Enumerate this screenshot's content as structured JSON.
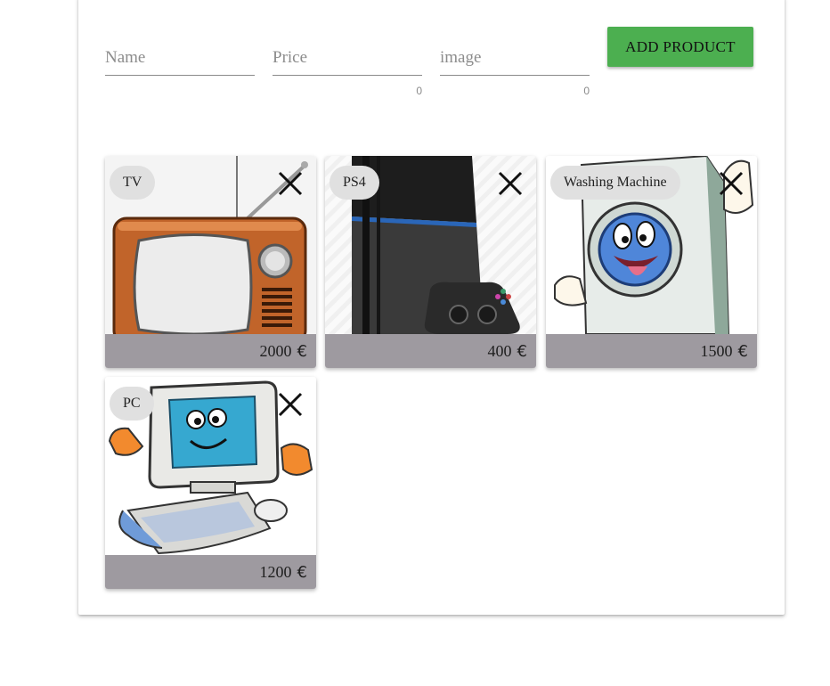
{
  "form": {
    "name": {
      "placeholder": "Name",
      "value": ""
    },
    "price": {
      "placeholder": "Price",
      "value": "",
      "counter": "0"
    },
    "image": {
      "placeholder": "image",
      "value": "",
      "counter": "0"
    },
    "add_button_label": "ADD PRODUCT"
  },
  "products": [
    {
      "name": "TV",
      "price": "2000",
      "currency": "€"
    },
    {
      "name": "PS4",
      "price": "400",
      "currency": "€"
    },
    {
      "name": "Washing Machine",
      "price": "1500",
      "currency": "€"
    },
    {
      "name": "PC",
      "price": "1200",
      "currency": "€"
    }
  ],
  "colors": {
    "add_button": "#4caf50",
    "card_footer": "#9e9aa0",
    "chip": "#e0e0e0"
  },
  "icons": {
    "remove": "close-icon"
  }
}
